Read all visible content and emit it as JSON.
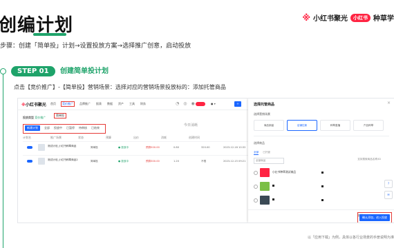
{
  "header": {
    "title": "创编计划",
    "subtitle": "步骤：创建「简单投」计划→设置投放方案→选择推广创意，启动投放",
    "brand": {
      "star": "※",
      "name": "小红书聚光",
      "badge": "小红书",
      "tail": "种草学"
    }
  },
  "step": {
    "number": "STEP 01",
    "title": "创建简单投计划",
    "instruction": "点击【竞价推广】-【简单投】营销场景：选择对应的营销场景投放标的：添加托管商品"
  },
  "screenshot": {
    "logo": "小红书聚光",
    "nav": [
      "首页",
      "竞价推广",
      "品牌推广",
      "报表",
      "数据",
      "资产",
      "工具",
      "财务"
    ],
    "nav_active_index": 1,
    "tip_label": "简单投",
    "row2_label": "投放类型",
    "row2_value": "竞价推广",
    "tabs": [
      "新建计划",
      "全部",
      "投放中",
      "已暂停",
      "待审核",
      "已结束"
    ],
    "tab_bar_right": "今日消耗",
    "table_headers": [
      "计划名",
      "推广场景",
      "状态",
      "预算",
      "出价",
      "消耗",
      "创建时间"
    ],
    "rows": [
      {
        "name": "测试计划_小红书种草商品",
        "scene": "简单投",
        "status": "● 投放中",
        "budget": "预算500.00",
        "bid": "0.80",
        "spend": "320.00",
        "time": "2023-12-18 10:32"
      },
      {
        "name": "测试计划_小红书种草商品2",
        "scene": "简单投",
        "status": "● 投放中",
        "budget": "预算300.00",
        "bid": "1.20",
        "spend": "不限",
        "time": "2023-12-15 09:21"
      }
    ],
    "panel": {
      "title": "选择托管商品",
      "section1": "选择营销场景",
      "scenes": [
        "商品销量",
        "店铺拉新",
        "种草直播",
        "产品种草"
      ],
      "scene_active_index": 1,
      "section2": "选择商品",
      "tabs": [
        "全部",
        "已托管"
      ],
      "filter": "全部商品",
      "search": "支持搜索商品名称/ID",
      "products": [
        {
          "name": "小红书种草测试商品",
          "color": "#ff2442"
        },
        {
          "name": "",
          "color": "#7bbf45"
        },
        {
          "name": "",
          "color": "#3b4a55"
        }
      ],
      "cancel": "取消",
      "confirm": "确认添加，进入投放"
    }
  },
  "footnote": "以「应用下载」为例，具体以各行业场景的手册说明为准"
}
